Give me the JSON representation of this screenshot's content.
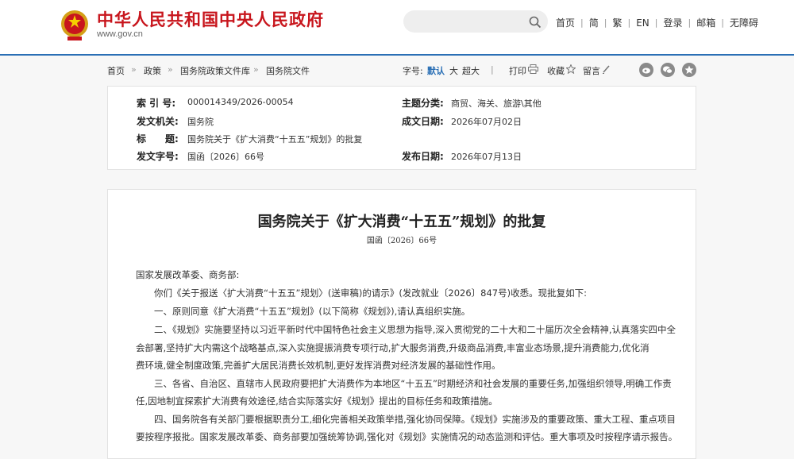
{
  "header": {
    "site_name": "中华人民共和国中央人民政府",
    "site_url": "www.gov.cn",
    "nav": [
      "首页",
      "简",
      "繁",
      "EN",
      "登录",
      "邮箱",
      "无障碍"
    ],
    "nav_separator": "|"
  },
  "breadcrumb": {
    "items": [
      "首页",
      "政策",
      "国务院政策文件库",
      "国务院文件"
    ],
    "separator": "»"
  },
  "tools": {
    "font_label": "字号:",
    "font_default": "默认",
    "font_large": "大",
    "font_xlarge": "超大",
    "divider": "|",
    "print": "打印",
    "favorite": "收藏",
    "comment": "留言"
  },
  "meta": {
    "index_label": "索 引 号:",
    "index_value": "000014349/2026-00054",
    "topic_label": "主题分类:",
    "topic_value": "商贸、海关、旅游\\其他",
    "issuer_label": "发文机关:",
    "issuer_value": "国务院",
    "date_written_label": "成文日期:",
    "date_written_value": "2026年07月02日",
    "title_label": "标　　题:",
    "title_value": "国务院关于《扩大消费“十五五”规划》的批复",
    "doc_no_label": "发文字号:",
    "doc_no_value": "国函〔2026〕66号",
    "pub_date_label": "发布日期:",
    "pub_date_value": "2026年07月13日"
  },
  "document": {
    "title": "国务院关于《扩大消费“十五五”规划》的批复",
    "number": "国函〔2026〕66号",
    "lines": [
      "国家发展改革委、商务部:",
      "你们《关于报送〈扩大消费“十五五”规划〉(送审稿)的请示》(发改就业〔2026〕847号)收悉。现批复如下:",
      "一、原则同意《扩大消费“十五五”规划》(以下简称《规划》),请认真组织实施。",
      "二、《规划》实施要坚持以习近平新时代中国特色社会主义思想为指导,深入贯彻党的二十大和二十届历次全会精神,认真落实四中全",
      "会部署,坚持扩大内需这个战略基点,深入实施提振消费专项行动,扩大服务消费,升级商品消费,丰富业态场景,提升消费能力,优化消",
      "费环境,健全制度政策,完善扩大居民消费长效机制,更好发挥消费对经济发展的基础性作用。",
      "三、各省、自治区、直辖市人民政府要把扩大消费作为本地区“十五五”时期经济和社会发展的重要任务,加强组织领导,明确工作责",
      "任,因地制宜探索扩大消费有效途径,结合实际落实好《规划》提出的目标任务和政策措施。",
      "四、国务院各有关部门要根据职责分工,细化完善相关政策举措,强化协同保障。《规划》实施涉及的重要政策、重大工程、重点项目",
      "要按程序报批。国家发展改革委、商务部要加强统筹协调,强化对《规划》实施情况的动态监测和评估。重大事项及时按程序请示报告。"
    ]
  },
  "colors": {
    "brand_red": "#c8161d",
    "link_blue": "#2a6fb5"
  },
  "icons": [
    "national-emblem-icon",
    "search-icon",
    "print-icon",
    "star-icon",
    "pencil-icon",
    "weibo-icon",
    "wechat-icon",
    "favorite-star-icon"
  ]
}
